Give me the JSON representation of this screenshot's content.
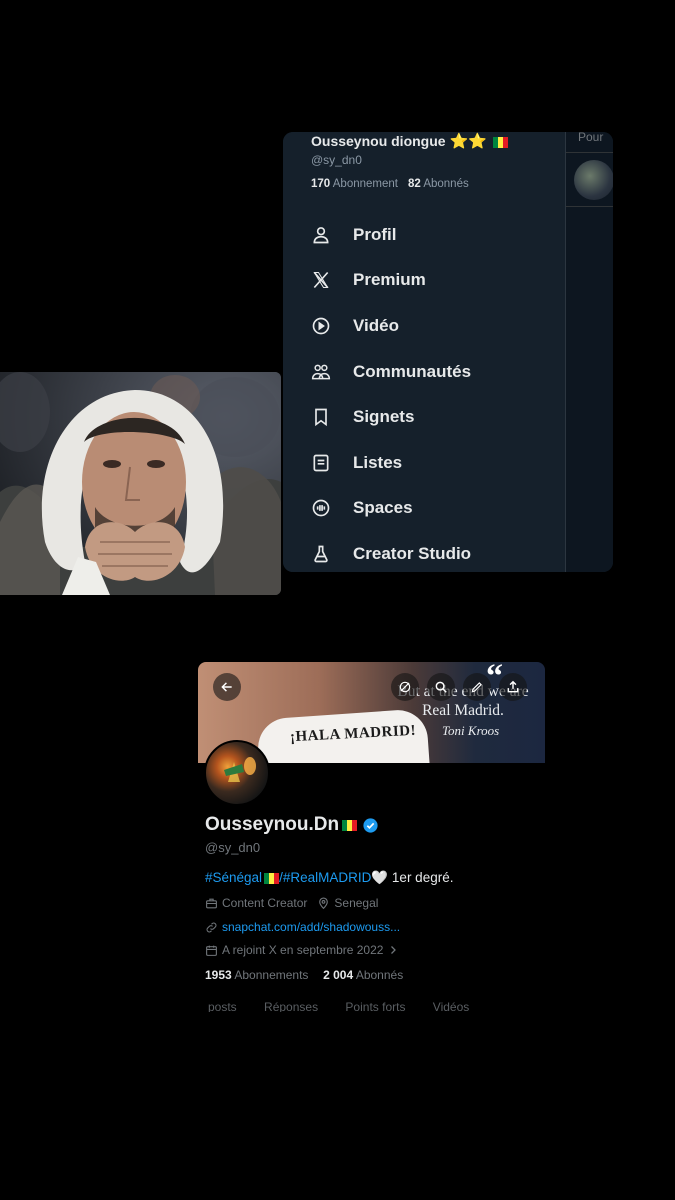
{
  "menu": {
    "account": {
      "name": "Ousseynou diongue",
      "emoji": "⭐⭐",
      "handle": "@sy_dn0",
      "following_count": "170",
      "following_label": "Abonnement",
      "followers_count": "82",
      "followers_label": "Abonnés"
    },
    "side_tab": "Pour",
    "items": [
      {
        "label": "Profil",
        "icon": "person-icon"
      },
      {
        "label": "Premium",
        "icon": "x-logo-icon"
      },
      {
        "label": "Vidéo",
        "icon": "play-circle-icon"
      },
      {
        "label": "Communautés",
        "icon": "people-icon"
      },
      {
        "label": "Signets",
        "icon": "bookmark-icon"
      },
      {
        "label": "Listes",
        "icon": "list-icon"
      },
      {
        "label": "Spaces",
        "icon": "spaces-icon"
      },
      {
        "label": "Creator Studio",
        "icon": "flask-icon"
      }
    ]
  },
  "profile": {
    "banner": {
      "quote": "But at the end we are Real Madrid.",
      "author": "Toni Kroos",
      "jersey_text": "¡HALA MADRID!"
    },
    "name": "Ousseynou.Dn",
    "handle": "@sy_dn0",
    "bio": {
      "tag1": "#Sénégal",
      "separator": "/",
      "tag2": "#RealMADRID",
      "heart": "🤍",
      "rest": " 1er degré."
    },
    "category": "Content Creator",
    "location": "Senegal",
    "link": "snapchat.com/add/shadowouss...",
    "joined": "A rejoint X en septembre 2022",
    "following_count": "1953",
    "following_label": "Abonnements",
    "followers_count": "2 004",
    "followers_label": "Abonnés",
    "tabs": [
      "posts",
      "Réponses",
      "Points forts",
      "Vidéos"
    ]
  },
  "colors": {
    "accent": "#1d9bf0",
    "panel_bg": "#15202b",
    "flag_green": "#00853f",
    "flag_yellow": "#fdef42",
    "flag_red": "#e31b23"
  }
}
